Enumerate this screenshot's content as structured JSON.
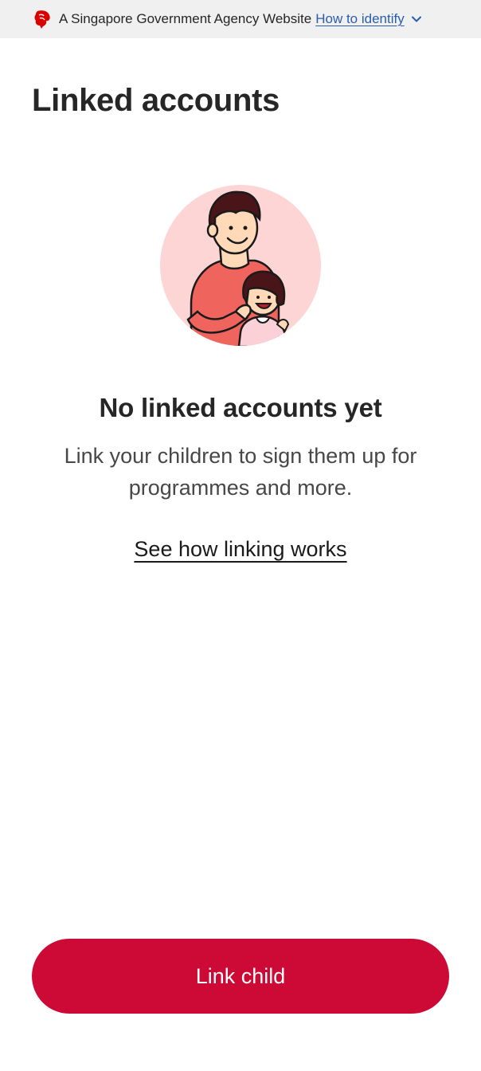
{
  "masthead": {
    "icon": "lion-head-icon",
    "text": "A Singapore Government Agency Website",
    "link_label": "How to identify",
    "chevron_icon": "chevron-down-icon",
    "accent_color": "#db0000",
    "link_color": "#2a5ea8"
  },
  "page": {
    "title": "Linked accounts"
  },
  "empty_state": {
    "illustration": "parent-and-child-illustration",
    "title": "No linked accounts yet",
    "description": "Link your children to sign them up for programmes and more.",
    "link_label": "See how linking works"
  },
  "actions": {
    "primary_label": "Link child",
    "primary_color": "#cc0a35"
  }
}
